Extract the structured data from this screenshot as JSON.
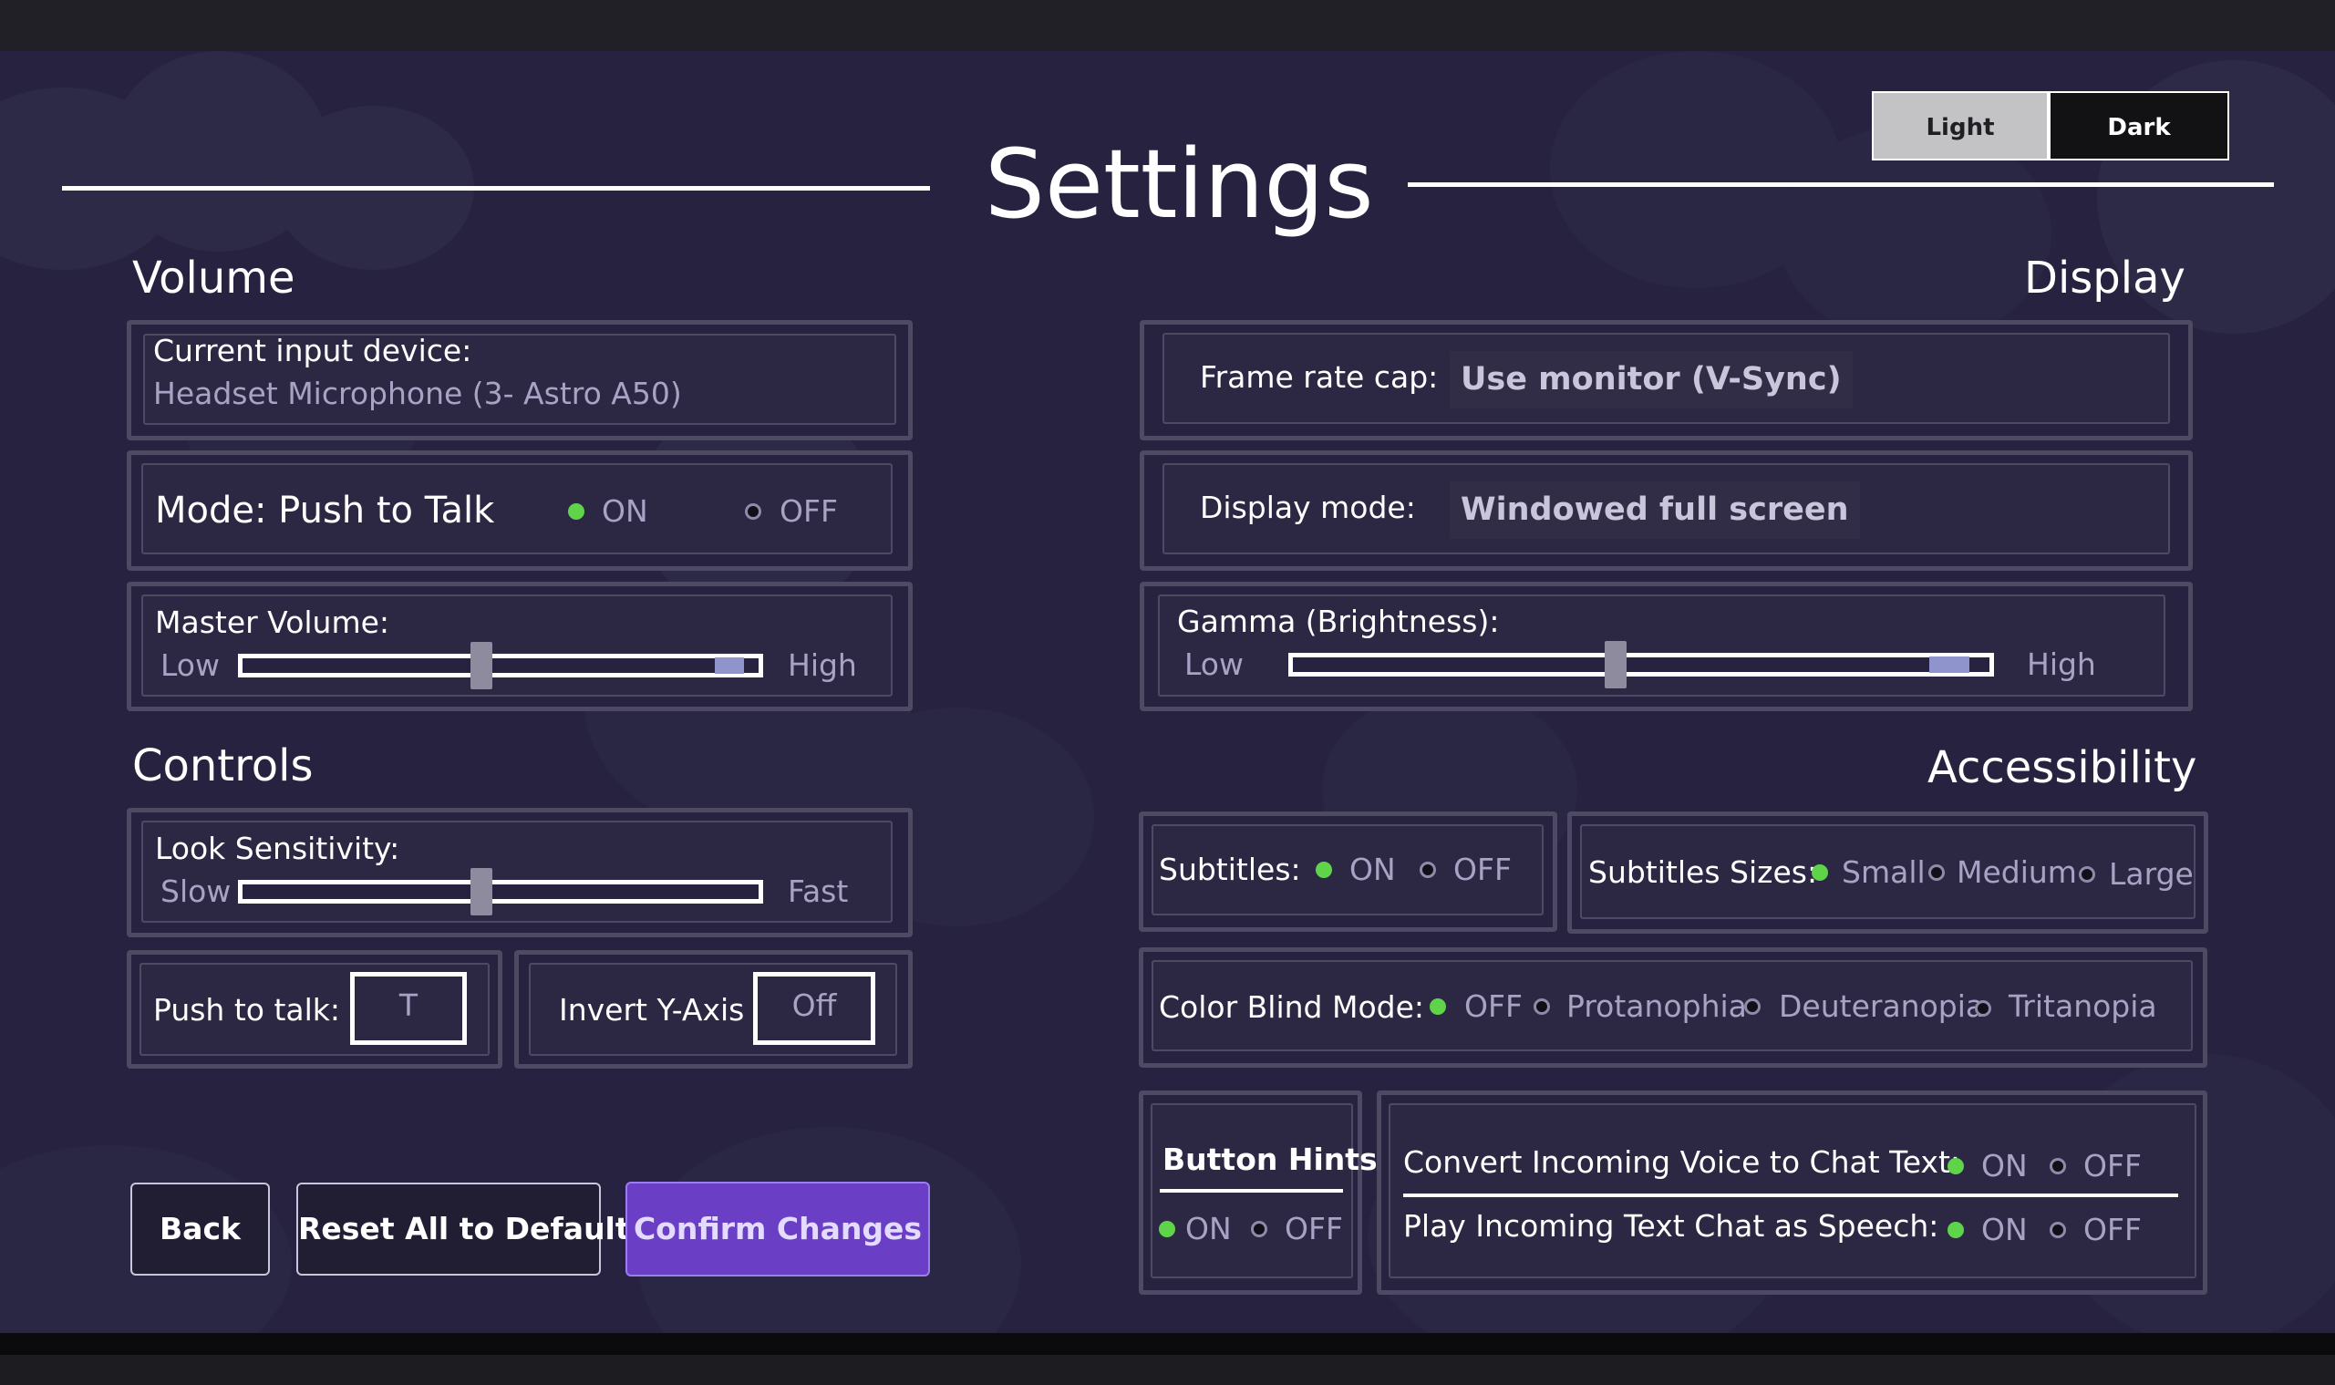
{
  "page_title": "Settings",
  "theme_toggle": {
    "light": "Light",
    "dark": "Dark",
    "selected": "Dark"
  },
  "volume": {
    "title": "Volume",
    "input_device_label": "Current input device:",
    "input_device_value": "Headset Microphone (3- Astro A50)",
    "mode_label": "Mode: Push to Talk",
    "mode_on": "ON",
    "mode_off": "OFF",
    "mode_selected": "ON",
    "master_label": "Master Volume:",
    "master_low": "Low",
    "master_high": "High",
    "master_level": 0.46
  },
  "controls": {
    "title": "Controls",
    "look_label": "Look Sensitivity:",
    "look_slow": "Slow",
    "look_fast": "Fast",
    "look_level": 0.46,
    "ptt_label": "Push to talk:",
    "ptt_key": "T",
    "invert_label": "Invert Y-Axis",
    "invert_value": "Off"
  },
  "display": {
    "title": "Display",
    "frame_label": "Frame rate cap:",
    "frame_value": "Use monitor (V-Sync)",
    "mode_label": "Display mode:",
    "mode_value": "Windowed full screen",
    "gamma_label": "Gamma (Brightness):",
    "gamma_low": "Low",
    "gamma_high": "High",
    "gamma_level": 0.46
  },
  "accessibility": {
    "title": "Accessibility",
    "subtitles_label": "Subtitles:",
    "subtitles_on": "ON",
    "subtitles_off": "OFF",
    "subtitles_selected": "ON",
    "sizes_label": "Subtitles Sizes:",
    "sizes": [
      "Small",
      "Medium",
      "Large"
    ],
    "sizes_selected": "Small",
    "colorblind_label": "Color Blind Mode:",
    "colorblind_options": [
      "OFF",
      "Protanophia",
      "Deuteranopia",
      "Tritanopia"
    ],
    "colorblind_selected": "OFF",
    "hints_label": "Button Hints",
    "hints_on": "ON",
    "hints_off": "OFF",
    "hints_selected": "ON",
    "voice_to_chat_label": "Convert Incoming Voice to Chat Text:",
    "voice_on": "ON",
    "voice_off": "OFF",
    "chat_to_speech_label": "Play Incoming Text Chat as Speech:",
    "speech_on": "ON",
    "speech_off": "OFF"
  },
  "buttons": {
    "back": "Back",
    "reset": "Reset All to Default",
    "confirm": "Confirm Changes"
  },
  "colors": {
    "background": "#262240",
    "accent_on": "#5fd44a",
    "primary_button": "#6a3fc6"
  }
}
